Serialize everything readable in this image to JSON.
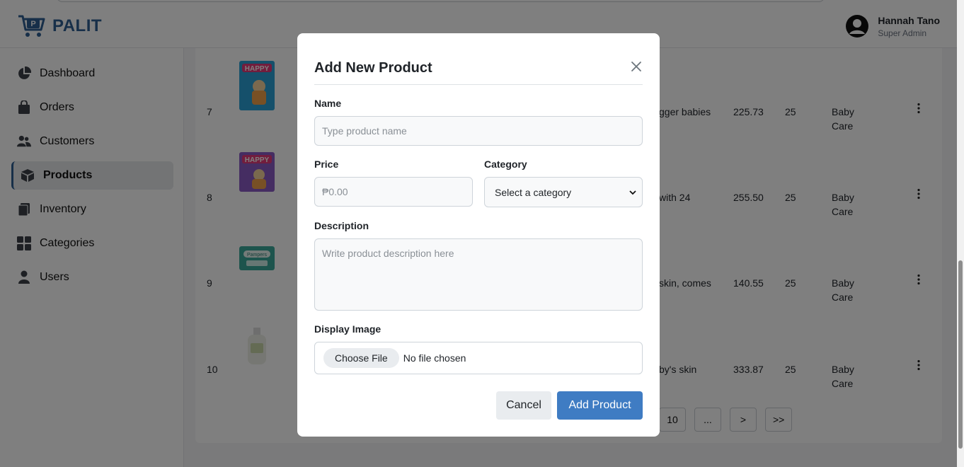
{
  "app": {
    "brand": "PALIT"
  },
  "user": {
    "name": "Hannah Tano",
    "role": "Super Admin"
  },
  "sidebar": {
    "items": [
      {
        "label": "Dashboard",
        "icon": "pie-chart-icon"
      },
      {
        "label": "Orders",
        "icon": "shopping-bag-icon"
      },
      {
        "label": "Customers",
        "icon": "users-icon"
      },
      {
        "label": "Products",
        "icon": "box-icon",
        "active": true
      },
      {
        "label": "Inventory",
        "icon": "clipboard-icon"
      },
      {
        "label": "Categories",
        "icon": "grid-icon"
      },
      {
        "label": "Users",
        "icon": "user-icon"
      }
    ]
  },
  "table": {
    "rows": [
      {
        "num": "7",
        "desc": "gger babies",
        "price": "225.73",
        "stock": "25",
        "category_line1": "Baby",
        "category_line2": "Care"
      },
      {
        "num": "8",
        "desc": "with 24",
        "price": "255.50",
        "stock": "25",
        "category_line1": "Baby",
        "category_line2": "Care"
      },
      {
        "num": "9",
        "desc": "skin, comes",
        "price": "140.55",
        "stock": "25",
        "category_line1": "Baby",
        "category_line2": "Care"
      },
      {
        "num": "10",
        "desc": "by's skin",
        "price": "333.87",
        "stock": "25",
        "category_line1": "Baby",
        "category_line2": "Care"
      }
    ]
  },
  "pagination": {
    "page_10": "10",
    "ellipsis": "...",
    "next": ">",
    "last": ">>"
  },
  "modal": {
    "title": "Add New Product",
    "name_label": "Name",
    "name_placeholder": "Type product name",
    "price_label": "Price",
    "price_placeholder": "₱0.00",
    "category_label": "Category",
    "category_selected": "Select a category",
    "description_label": "Description",
    "description_placeholder": "Write product description here",
    "image_label": "Display Image",
    "choose_file": "Choose File",
    "no_file": "No file chosen",
    "cancel": "Cancel",
    "submit": "Add Product"
  },
  "colors": {
    "brand": "#2f5f92",
    "primary_button": "#3f7cc3",
    "overlay": "rgba(0,0,0,0.5)"
  }
}
